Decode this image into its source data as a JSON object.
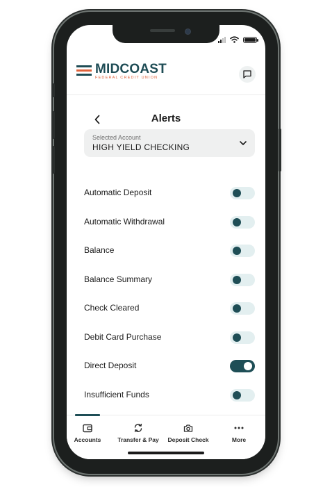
{
  "brand": {
    "name": "MIDCOAST",
    "subtitle": "FEDERAL CREDIT UNION",
    "bar_colors": [
      "#1e4c55",
      "#e0623b",
      "#1e4c55"
    ]
  },
  "colors": {
    "accent": "#1e4e56",
    "toggle_off_track": "#e3eff0"
  },
  "header": {
    "chat_icon": "chat-icon"
  },
  "page": {
    "title": "Alerts",
    "back_icon": "chevron-left-icon"
  },
  "account": {
    "label": "Selected Account",
    "value": "HIGH YIELD CHECKING",
    "dropdown_icon": "chevron-down-icon"
  },
  "alerts": [
    {
      "label": "Automatic Deposit",
      "enabled": false
    },
    {
      "label": "Automatic Withdrawal",
      "enabled": false
    },
    {
      "label": "Balance",
      "enabled": false
    },
    {
      "label": "Balance Summary",
      "enabled": false
    },
    {
      "label": "Check Cleared",
      "enabled": false
    },
    {
      "label": "Debit Card Purchase",
      "enabled": false
    },
    {
      "label": "Direct Deposit",
      "enabled": true
    },
    {
      "label": "Insufficient Funds",
      "enabled": false
    }
  ],
  "tabs": [
    {
      "label": "Accounts",
      "icon": "wallet-icon",
      "active": true
    },
    {
      "label": "Transfer & Pay",
      "icon": "transfer-icon",
      "active": false
    },
    {
      "label": "Deposit Check",
      "icon": "camera-icon",
      "active": false
    },
    {
      "label": "More",
      "icon": "more-icon",
      "active": false
    }
  ]
}
